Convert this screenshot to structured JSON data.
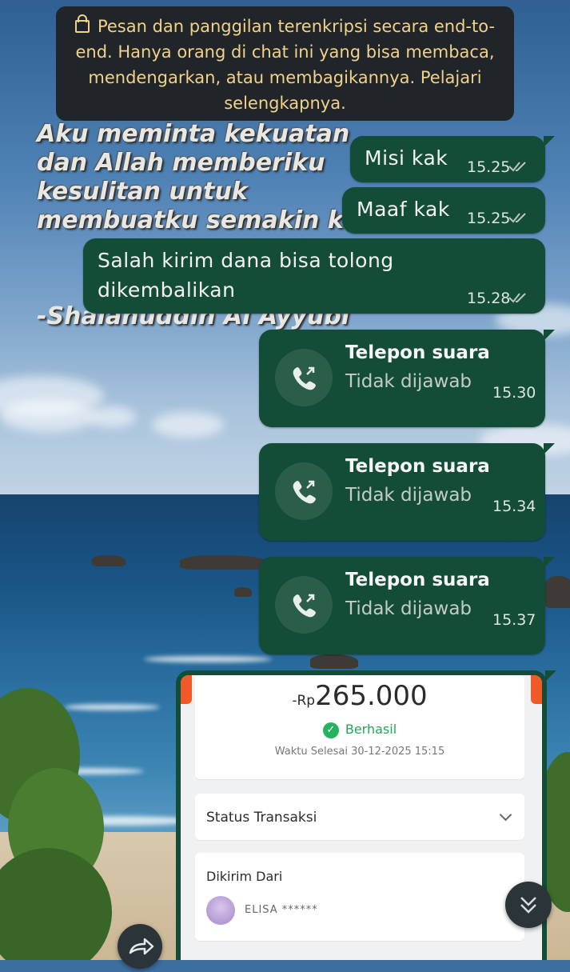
{
  "notice": {
    "text": "Pesan dan panggilan terenkripsi secara end-to-end. Hanya orang di chat ini yang bisa membaca, mendengarkan, atau membagikannya. Pelajari selengkapnya."
  },
  "wallpaper": {
    "quote": "Aku meminta kekuatan dan Allah memberiku kesulitan untuk membuatku semakin kuat",
    "author": "-Shalahuddin Al Ayyubi"
  },
  "messages": [
    {
      "text": "Misi kak",
      "time": "15.25"
    },
    {
      "text": "Maaf kak",
      "time": "15.25"
    },
    {
      "text": "Salah kirim dana bisa tolong dikembalikan",
      "time": "15.28"
    }
  ],
  "calls": [
    {
      "title": "Telepon suara",
      "status": "Tidak dijawab",
      "time": "15.30"
    },
    {
      "title": "Telepon suara",
      "status": "Tidak dijawab",
      "time": "15.34"
    },
    {
      "title": "Telepon suara",
      "status": "Tidak dijawab",
      "time": "15.37"
    }
  ],
  "receipt": {
    "currency": "-Rp",
    "amount": "265.000",
    "status": "Berhasil",
    "completed_time": "Waktu Selesai 30-12-2025 15:15",
    "status_section_label": "Status Transaksi",
    "sender_label": "Dikirim Dari",
    "sender_name": "ELISA ******"
  },
  "icons": {
    "lock": "lock-icon",
    "read_ticks": "double-check-icon",
    "call": "outgoing-call-icon",
    "success": "check-circle-icon",
    "chevron": "chevron-down-icon",
    "scroll_down": "double-chevron-down-icon",
    "forward": "forward-arrow-icon"
  },
  "colors": {
    "bubble": "#144d37",
    "notice_bg": "#1f2529",
    "notice_text": "#f2d28a",
    "ticks": "#b9c7bf",
    "success": "#26a35a",
    "receipt_accent": "#f05a28"
  }
}
